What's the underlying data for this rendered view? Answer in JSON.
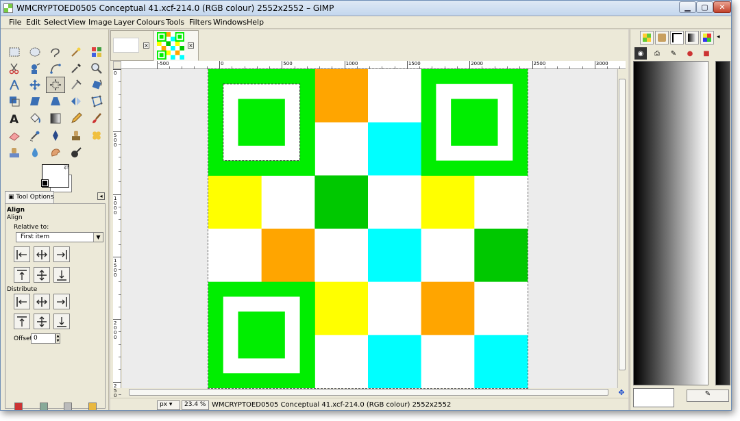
{
  "window": {
    "title": "WMCRYPTOED0505 Conceptual 41.xcf-214.0 (RGB colour) 2552x2552 – GIMP",
    "min": "▁",
    "max": "▢",
    "close": "✕"
  },
  "menu": [
    "File",
    "Edit",
    "Select",
    "View",
    "Image",
    "Layer",
    "Colours",
    "Tools",
    "Filters",
    "Windows",
    "Help"
  ],
  "toolbox": {
    "tool_options_tab": "Tool Options",
    "header1": "Align",
    "header2": "Align",
    "relative_label": "Relative to:",
    "relative_value": "First item",
    "distribute_label": "Distribute",
    "offset_label": "Offset:",
    "offset_value": "0"
  },
  "rulers": {
    "h_labels": [
      "-500",
      "0",
      "500",
      "1000",
      "1500",
      "2000",
      "2500",
      "3000"
    ],
    "v_labels": [
      "0",
      "500",
      "1000",
      "1500",
      "2000",
      "2500"
    ]
  },
  "status": {
    "unit": "px",
    "zoom": "23.4 %",
    "text": "WMCRYPTOED0505 Conceptual 41.xcf-214.0 (RGB colour) 2552x2552"
  },
  "image_grid": {
    "colors": {
      "g": "#00ee00",
      "dg": "#00c800",
      "w": "#ffffff",
      "o": "#ffa500",
      "c": "#00ffff",
      "y": "#ffff00"
    },
    "cells": [
      [
        "finder",
        "finder",
        "o",
        "w",
        "finder",
        "finder"
      ],
      [
        "finder",
        "finder",
        "w",
        "c",
        "finder",
        "finder"
      ],
      [
        "y",
        "w",
        "dg",
        "w",
        "y",
        "w"
      ],
      [
        "w",
        "o",
        "w",
        "c",
        "w",
        "dg"
      ],
      [
        "finder",
        "finder",
        "y",
        "w",
        "o",
        "w"
      ],
      [
        "finder",
        "finder",
        "w",
        "c",
        "w",
        "c"
      ]
    ]
  }
}
